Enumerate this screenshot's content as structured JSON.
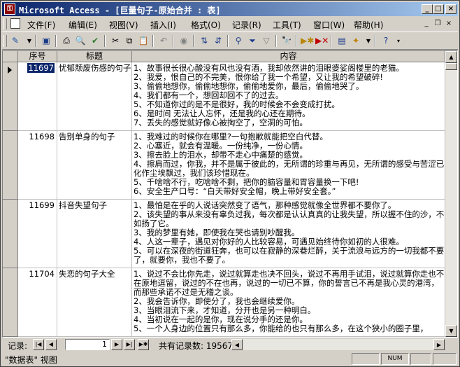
{
  "window": {
    "title": "Microsoft Access - [巨量句子-原始合并 : 表]",
    "app_icon": "access-key-icon"
  },
  "menu": {
    "items": [
      "文件(F)",
      "编辑(E)",
      "视图(V)",
      "插入(I)",
      "格式(O)",
      "记录(R)",
      "工具(T)",
      "窗口(W)",
      "帮助(H)"
    ]
  },
  "table": {
    "columns": [
      "序号",
      "标题",
      "内容"
    ],
    "rows": [
      {
        "id": "11697",
        "title": "忧郁颓废伤感的句子",
        "lines": [
          "1、故事很长很心酸没有风也没有酒，我却依然讲的泪眼婆娑阁楼里的老猫。",
          "2、我爱，恨自己的不完美，恨你给了我一个希望，又让我的希望破碎!",
          "3、偷偷地想你，偷偷地想你，偷偷地爱你，最后，偷偷地哭了。",
          "4、我们都有一个，想回却回不了的过去。",
          "5、不知道你过的是不是很好，我的时候会不会变成打扰。",
          "6、是时间 无法让人忘怀，还是我的心还在期待。",
          "7、丢失的感觉就好像心被掏空了，空洞的可怕。"
        ]
      },
      {
        "id": "11698",
        "title": "告别单身的句子",
        "lines": [
          "1、我难过的时候你在哪里?一句抱歉就能把空白代替。",
          "2、心塞近，就会有温暖。一份纯净，一份心情。",
          "3、擦去脸上的泪水，却带不走心中痛楚的感觉。",
          "4、擦肩而过，你我，并不是属于彼此的，无所谓的珍重与再见，无所谓的感受与苦涩已化作尘埃飘过，我们该珍惜现在。",
          "5、千啥啥不行，吃啥啥不剩，把你的脑容量和胃容量换一下吧!",
          "6、安全生产口号：“白天带好安全帽，晚上带好安全套。”"
        ]
      },
      {
        "id": "11699",
        "title": "抖音失望句子",
        "lines": [
          "1、最怕是在乎的人说话突然变了语气，那种感觉就像全世界都不要你了。",
          "2、该失望的事从来没有辜负过我，每次都是认认真真的让我失望，所以握不住的沙，不如扬了它。",
          "3、我的梦里有她，即使我在哭也请别吵醒我。",
          "4、人这一辈子，遇见对你好的人比较容易，可遇见始终待你如初的人很难。",
          "5、可以在深夜的街道狂奔，也可以在寂静的深巷烂醉，关于流浪与远方的一切我都不要了，就要你，我也不要了。"
        ]
      },
      {
        "id": "11704",
        "title": "失恋的句子大全",
        "lines": [
          "1、说过不会比你先走，说过就算走也决不回头，说过不再用手试泪，说过就算你走也不在原地逗留，说过的不在也再，说过的一切已不算，你的誓言已不再是我心灵的港湾，而那些承诺不过是无稽之谈。",
          "2、我会告诉你，即使分了，我也会继续爱你。",
          "3、当眼泪流下来，才知道，分开也是另一种明白。",
          "4、当初说在一起的是你，现在说分手的还是你。",
          "5、一个人身边的位置只有那么多，你能给的也只有那么多，在这个狭小的圈子里，"
        ]
      }
    ]
  },
  "navigator": {
    "label": "记录:",
    "current": "1",
    "count_text": "共有记录数: 19567"
  },
  "status": {
    "text": "\"数据表\" 视图",
    "num": "NUM"
  }
}
